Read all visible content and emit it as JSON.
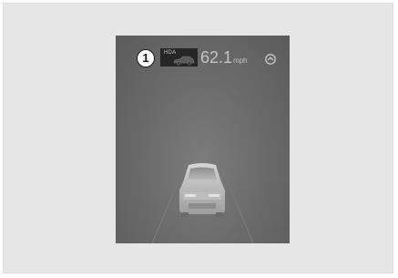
{
  "callout": {
    "number": "1"
  },
  "hda": {
    "label": "HDA",
    "icon": "car-side-icon"
  },
  "speed": {
    "value": "62.1",
    "unit": "mph"
  },
  "cruise": {
    "icon": "cruise-control-icon"
  },
  "scene": {
    "vehicle_icon": "own-vehicle-icon"
  },
  "colors": {
    "cluster_bg": "#6c6c6c",
    "hda_bg": "#262626",
    "text": "#c4c4c4"
  }
}
